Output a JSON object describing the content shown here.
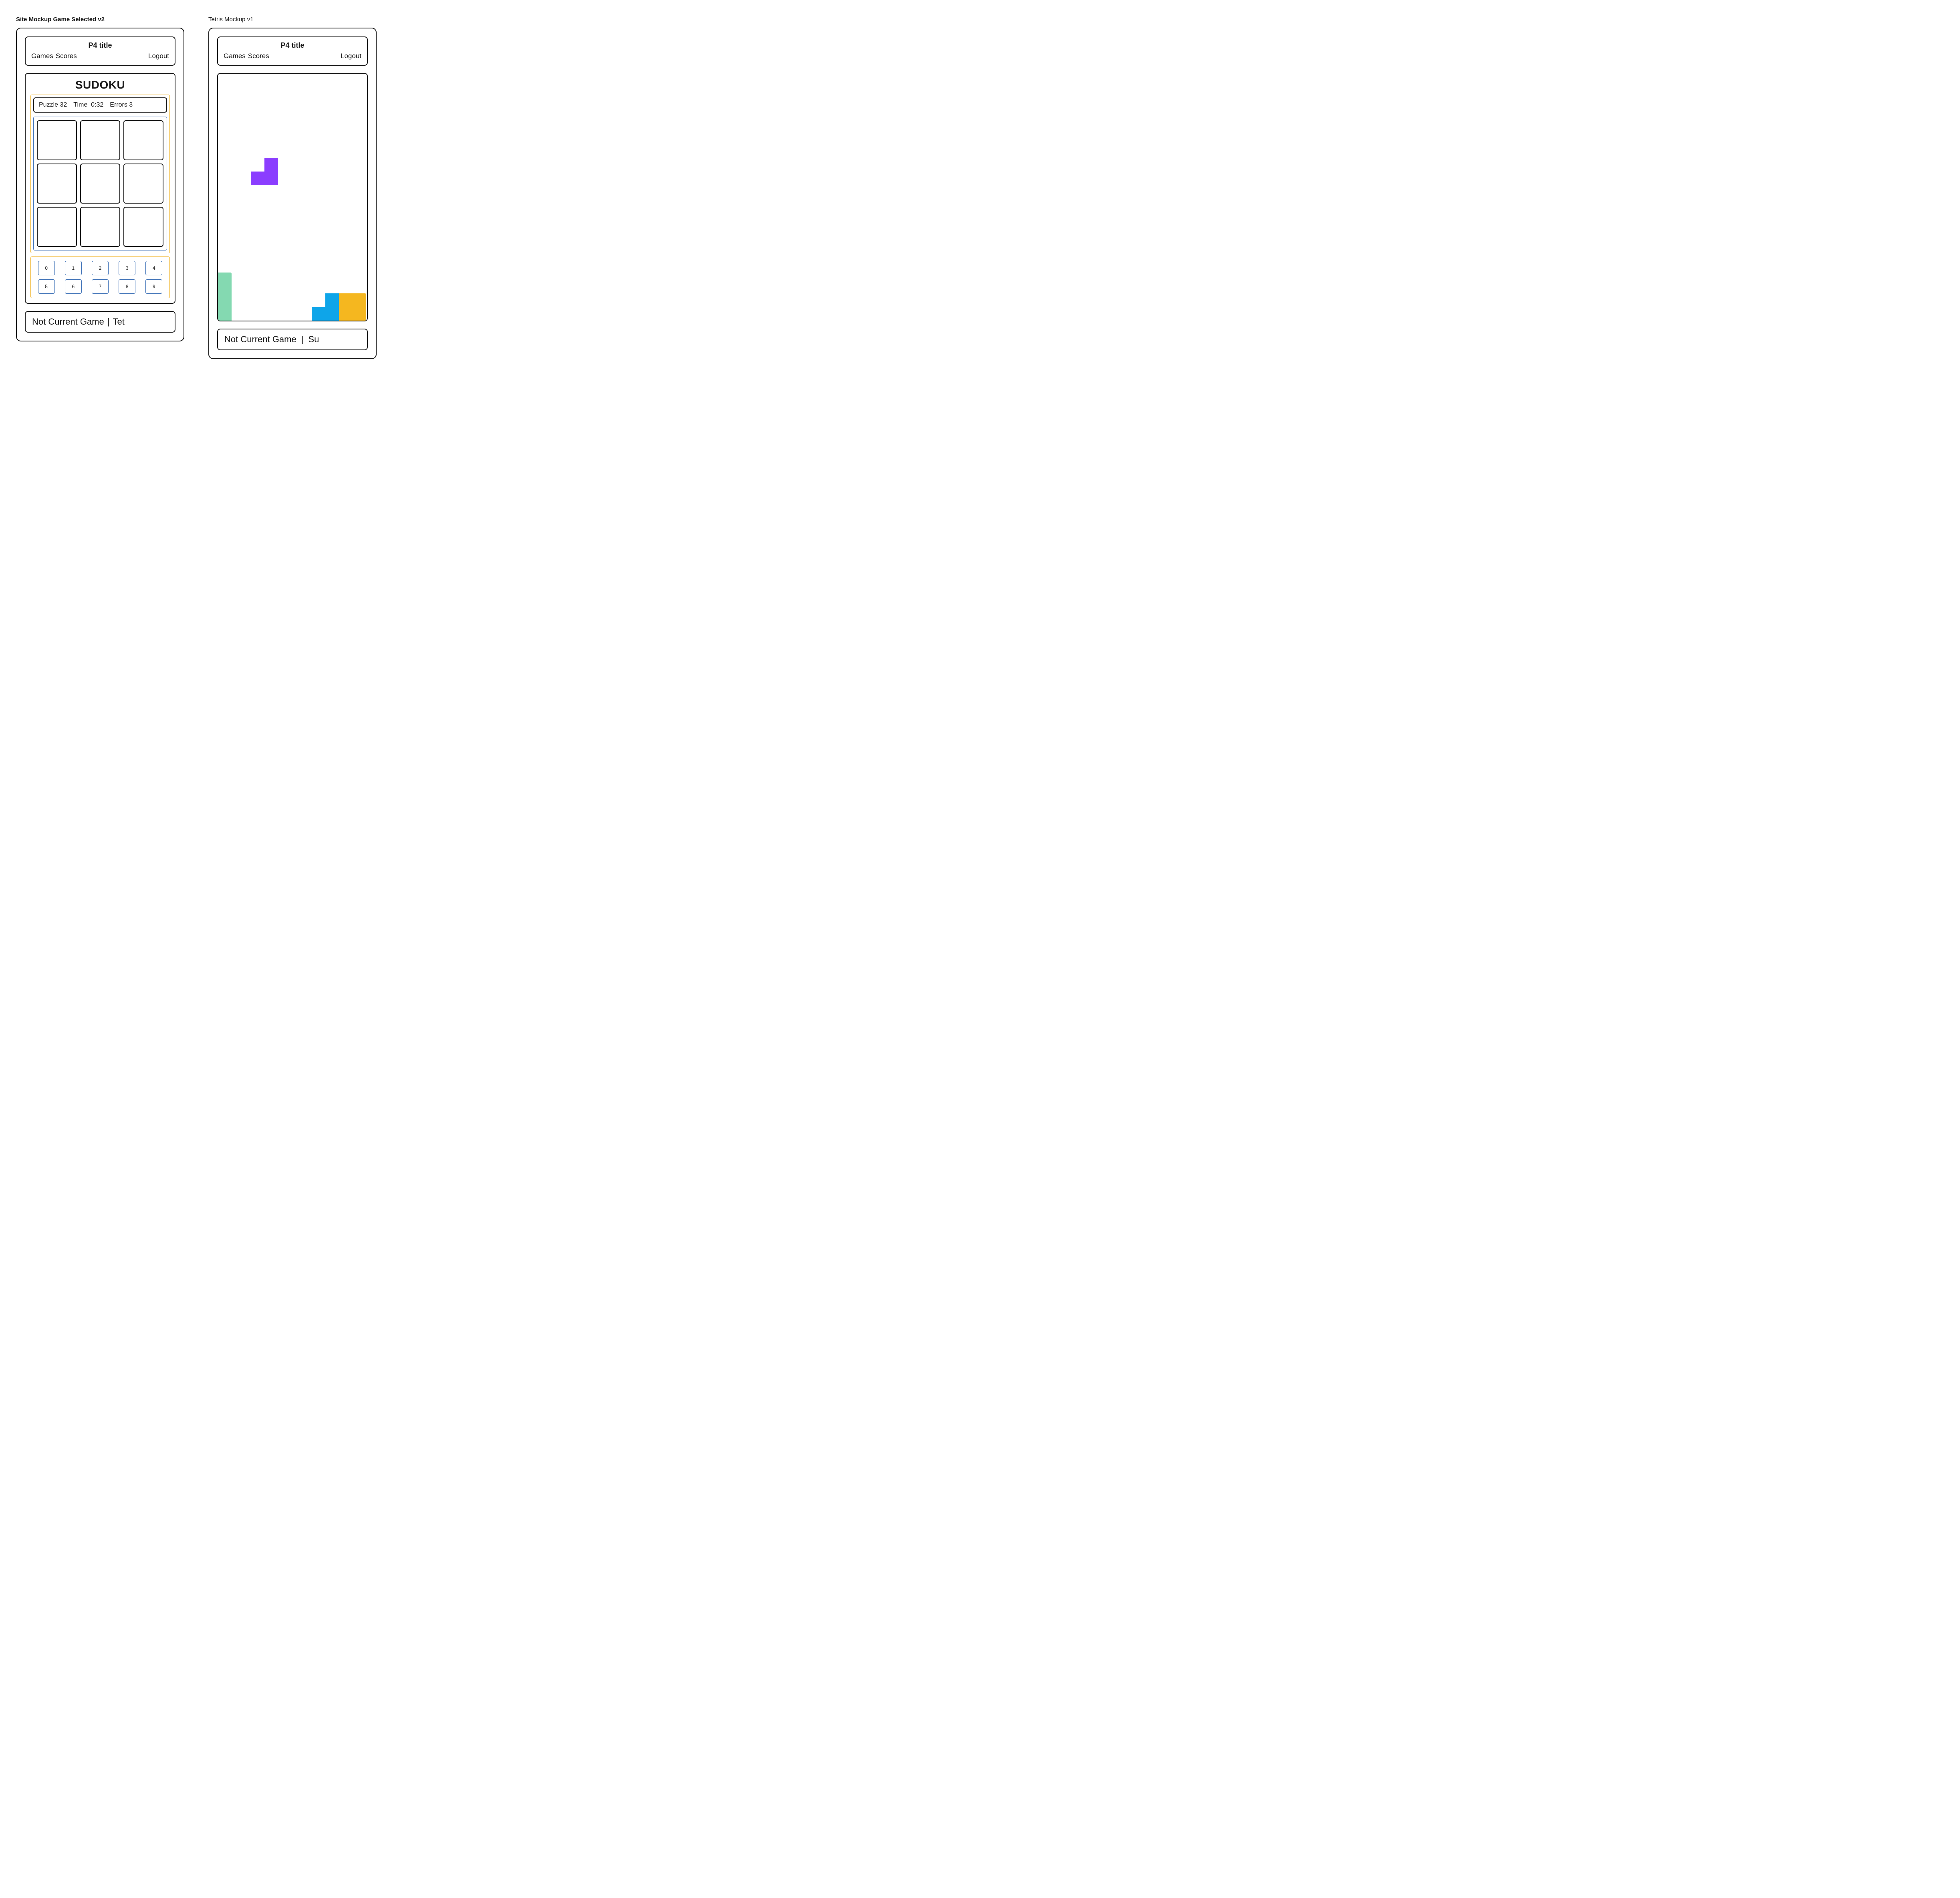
{
  "frames": {
    "left_label": "Site Mockup Game Selected v2",
    "right_label": "Tetris Mockup v1"
  },
  "header": {
    "title": "P4 title",
    "nav_games": "Games",
    "nav_scores": "Scores",
    "nav_logout": "Logout"
  },
  "sudoku": {
    "title": "SUDOKU",
    "stats": {
      "puzzle_label": "Puzzle",
      "puzzle_num": "32",
      "time_label": "Time",
      "time_value": "0:32",
      "errors_label": "Errors",
      "errors_value": "3"
    },
    "numpad": [
      "0",
      "1",
      "2",
      "3",
      "4",
      "5",
      "6",
      "7",
      "8",
      "9"
    ]
  },
  "tetris": {
    "pieces": [
      {
        "shape": "s-piece",
        "color": "#8b3dff"
      },
      {
        "shape": "i-piece",
        "color": "#84d9b1"
      },
      {
        "shape": "j-piece",
        "color": "#0ea5e9"
      },
      {
        "shape": "o-piece",
        "color": "#f5b71f"
      }
    ]
  },
  "footer": {
    "left_text": "Not Current Game",
    "left_alt": "Tet",
    "right_text": "Not Current Game",
    "right_alt": "Su",
    "separator": "|"
  },
  "colors": {
    "border": "#1a1a1a",
    "accent_yellow": "#f0b429",
    "accent_blue": "#3b6fb6",
    "tet_purple": "#8b3dff",
    "tet_green": "#84d9b1",
    "tet_blue": "#0ea5e9",
    "tet_yellow": "#f5b71f"
  }
}
